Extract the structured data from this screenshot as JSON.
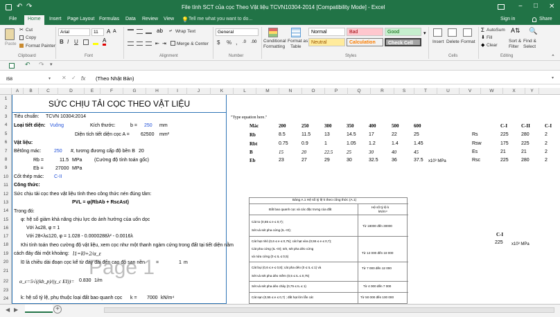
{
  "title": "File tính SCT của cọc Theo Vật liệu TCVN10304-2014 [Compatibility Mode] - Excel",
  "window": {
    "min": "−",
    "restore": "□",
    "close": "✕"
  },
  "tabs": [
    "File",
    "Home",
    "Insert",
    "Page Layout",
    "Formulas",
    "Data",
    "Review",
    "View"
  ],
  "tell_me": "Tell me what you want to do...",
  "sign_in": "Sign in",
  "share": "Share",
  "ribbon": {
    "cut": "Cut",
    "copy": "Copy",
    "paste": "Paste",
    "format_painter": "Format Painter",
    "font_name": "Arial",
    "font_size": "11",
    "bold": "B",
    "italic": "I",
    "underline": "U",
    "wrap_text": "Wrap Text",
    "merge_center": "Merge & Center",
    "number_format": "General",
    "currency": "$",
    "percent": "%",
    "comma": ",",
    "conditional": "Conditional",
    "formatting": "Formatting",
    "format_as": "Format as",
    "table": "Table",
    "styles": {
      "normal": "Normal",
      "bad": "Bad",
      "good": "Good",
      "neutral": "Neutral",
      "calculation": "Calculation",
      "check_cell": "Check Cell"
    },
    "insert": "Insert",
    "delete": "Delete",
    "format": "Format",
    "autosum": "AutoSum",
    "fill": "Fill",
    "clear": "Clear",
    "sort_filter": "Sort & Filter",
    "sort_filter_line1": "Sort &",
    "sort_filter_line2": "Filter",
    "find_select": "Find & Select",
    "find_select_line1": "Find &",
    "find_select_line2": "Select",
    "groups": {
      "clipboard": "Clipboard",
      "font": "Font",
      "alignment": "Alignment",
      "number": "Number",
      "styles": "Styles",
      "cells": "Cells",
      "editing": "Editing"
    }
  },
  "formula_bar": {
    "name_box": "I58",
    "fx": "fx",
    "value": "(Theo Nhật Bản)"
  },
  "columns": [
    "A",
    "B",
    "C",
    "D",
    "E",
    "F",
    "G",
    "H",
    "I",
    "J",
    "K",
    "L",
    "M",
    "N",
    "O",
    "P",
    "Q",
    "R",
    "S",
    "T",
    "U",
    "V",
    "W",
    "X",
    "Y"
  ],
  "rows": [
    "1",
    "2",
    "3",
    "4",
    "5",
    "6",
    "7",
    "8",
    "9",
    "10",
    "11",
    "12",
    "13",
    "14",
    "15",
    "16",
    "17",
    "18",
    "19",
    "20",
    "21",
    "22",
    "23",
    "24"
  ],
  "sheet": {
    "title": "SỨC CHỊU TẢI CỌC THEO VẬT LIỆU",
    "tieu_chuan_label": "Tiêu chuẩn:",
    "tieu_chuan_val": "TCVN 10304:2014",
    "loai_tiet_dien_label": "Loại tiết diện:",
    "loai_tiet_dien_val": "Vuông",
    "kich_thuoc_label": "Kích thước:",
    "b_label": "b =",
    "b_val": "250",
    "b_unit": "mm",
    "dien_tich_label": "Diện tích tiết diện cọc A =",
    "dien_tich_val": "62500",
    "dien_tich_unit": "mm²",
    "vat_lieu": "Vật liệu:",
    "be_tong_mac_label": "Bêtông mác:",
    "be_tong_mac_val": "250",
    "tuong_duong": "#, tương đương cấp độ bền B",
    "tuong_duong_val": "20",
    "rb_label": "Rb =",
    "rb_val": "11.5",
    "rb_unit": "MPa",
    "rb_note": "(Cường độ tính toán gốc)",
    "eb_label": "Eb =",
    "eb_val": "27000",
    "eb_unit": "MPa",
    "cot_thep_label": "Cốt thép mác:",
    "cot_thep_val": "C-II",
    "cong_thuc": "Công thức:",
    "line12": "Sức chịu tải cọc theo vật liệu tính theo công thức nén đúng tâm:",
    "formula13": "PVL = φ(RbAb + RscAst)",
    "line14": "Trong đó:",
    "line15": "φ: hệ số giảm khả năng chịu lực do ảnh hưởng của uốn dọc",
    "line16": "Với λ≤28, φ = 1",
    "line17": "Với 28<λ≤120, φ = 1.028 - 0.0000288λ² - 0.0016λ",
    "line18": "Khi tính toán theo cường độ vật liệu, xem cọc như một thanh ngàm cứng trong đất tại tiết diện nằm",
    "line19a": "cách đáy đài một khoảng:",
    "line19b": "l1=l0+2/α_ε",
    "line20": "l0 là chiều dài đoạn cọc kể từ đáy đài đến cao độ san nền",
    "line20_eq": "=",
    "line20_val": "1",
    "line20_unit": "m",
    "line21a": "α_ε=5√((kb_p)/(γ_c EI))=",
    "line21_val": "0.830",
    "line21_unit": "1/m",
    "line23a": "k: hệ số tỷ lệ, phụ thuộc loại đất bao quanh cọc",
    "line23_k": "k =",
    "line23_val": "7000",
    "line23_unit": "kN/m⁴",
    "watermark": "Page 1"
  },
  "right": {
    "type_eq": "\"Type equation here.\"",
    "mac": "Mác",
    "headers": [
      "200",
      "250",
      "300",
      "350",
      "400",
      "500",
      "600"
    ],
    "rb": {
      "label": "Rb",
      "vals": [
        "8.5",
        "11.5",
        "13",
        "14.5",
        "17",
        "22",
        "25"
      ]
    },
    "rbt": {
      "label": "Rbt",
      "vals": [
        "0.75",
        "0.9",
        "1",
        "1.05",
        "1.2",
        "1.4",
        "1.45"
      ]
    },
    "b": {
      "label": "B",
      "vals": [
        "15",
        "20",
        "22.5",
        "25",
        "30",
        "40",
        "45"
      ]
    },
    "eb": {
      "label": "Eb",
      "vals": [
        "23",
        "27",
        "29",
        "30",
        "32.5",
        "36",
        "37.5"
      ],
      "unit": "x10³ MPa"
    },
    "steel_headers": [
      "C-I",
      "C-II",
      "C-I"
    ],
    "rs": {
      "label": "Rs",
      "vals": [
        "225",
        "280",
        "2"
      ]
    },
    "rsw": {
      "label": "Rsw",
      "vals": [
        "175",
        "225",
        "2"
      ]
    },
    "es": {
      "label": "Es",
      "vals": [
        "21",
        "21",
        "2"
      ]
    },
    "rsc": {
      "label": "Rsc",
      "vals": [
        "225",
        "280",
        "2"
      ]
    },
    "ci2": "C-I",
    "ci2_val": "225",
    "ci2_unit": "x10³ MPa"
  },
  "table_a": {
    "caption": "Bảng A.1 Hệ số tỷ lệ k theo công thức (A.1)",
    "h1": "Đất bao quanh cọc và các đặc trưng của đất",
    "h2": "Hệ số tỷ lệ k",
    "h2b": "kN/m⁴",
    "r1a": "Cát to (0,55 ≤ e ≤ 0,7);",
    "r1b": "Sét và sét pha cứng (IL <0);",
    "r1v": "Từ 18000 đến 30000",
    "r2a": "Cát hạt nhỏ (0,6 ≤ e ≤ 0,75); cát hạt vừa (0,55 ≤ e ≤ 0,7);",
    "r2b": "Cát pha cứng (IL <0); sét, sét pha dẻo cứng",
    "r2c": "và nửa cứng (0 ≤ IL ≤ 0,5)",
    "r2v": "Từ 12 000 đến 18 000",
    "r3a": "Cát bụi (0,6 ≤ e ≤ 0,8); cát pha dẻo (0 ≤ IL ≤ 1) và",
    "r3b": "Sét và sét pha dẻo mềm (0,5 ≤ IL ≤ 0,75)",
    "r3v": "Từ 7 000 đến 12 000",
    "r4a": "Sét và sét pha dẻo chảy (0,75 ≤ IL ≤ 1)",
    "r4v": "Từ 4 000 đến 7 000",
    "r5a": "Cát sạn (0,55 ≤ e ≤ 0,7) ; đất hạt lớn lẫn cát",
    "r5v": "Từ 50 000 đến 100 000"
  },
  "sheet_tab_add": "+"
}
